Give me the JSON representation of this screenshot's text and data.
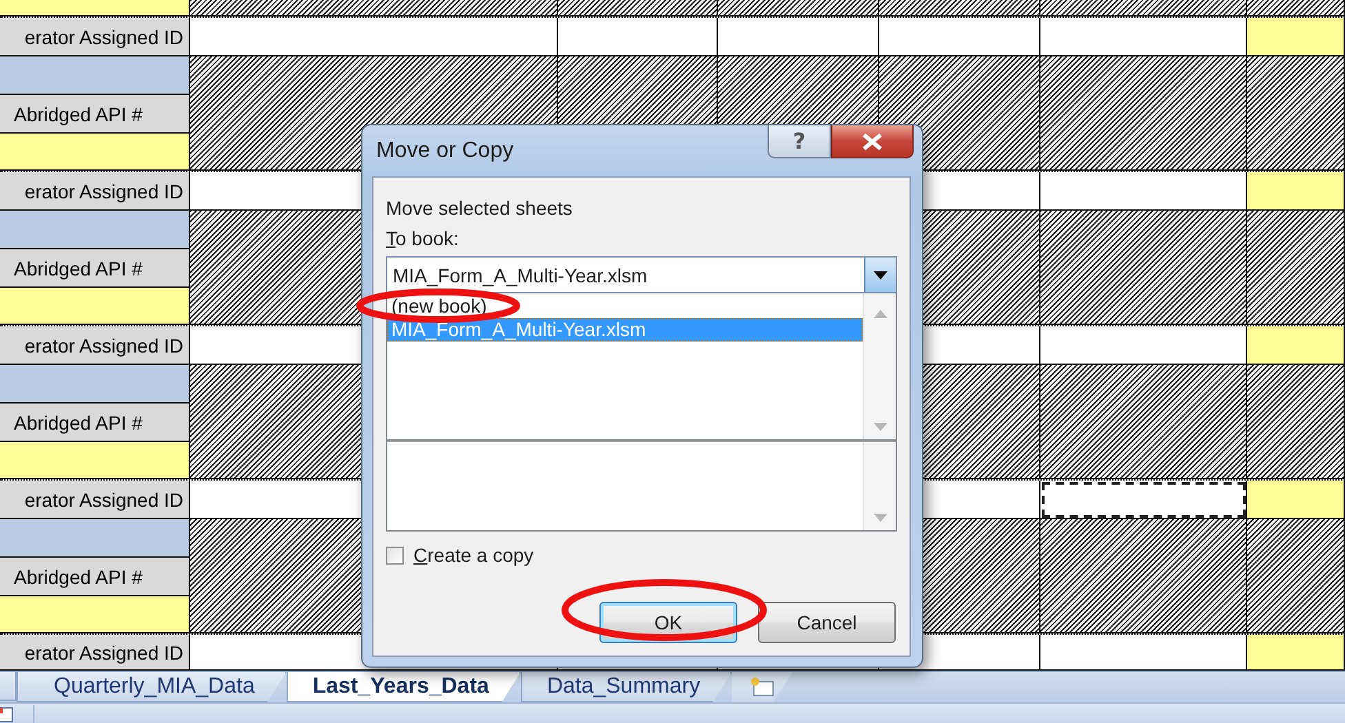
{
  "sheet": {
    "blocks": [
      {
        "id_label": "erator Assigned ID",
        "api_label": "Abridged API #",
        "selected": false
      },
      {
        "id_label": "erator Assigned ID",
        "api_label": "Abridged API #",
        "selected": false
      },
      {
        "id_label": "erator Assigned ID",
        "api_label": "Abridged API #",
        "selected": false
      },
      {
        "id_label": "erator Assigned ID",
        "api_label": "Abridged API #",
        "selected": true
      },
      {
        "id_label": "erator Assigned ID",
        "selected": false
      }
    ]
  },
  "sheet_tabs": [
    {
      "label": "Quarterly_MIA_Data",
      "selected": false
    },
    {
      "label": "Last_Years_Data",
      "selected": true
    },
    {
      "label": "Data_Summary",
      "selected": false
    }
  ],
  "dialog": {
    "title": "Move or Copy",
    "help_button": "?",
    "instruction": "Move selected sheets",
    "to_book_label": "To book:",
    "to_book_value": "MIA_Form_A_Multi-Year.xlsm",
    "list_items": [
      {
        "label": "(new book)",
        "selected": false,
        "circled": true
      },
      {
        "label": "MIA_Form_A_Multi-Year.xlsm",
        "selected": true,
        "circled": false
      }
    ],
    "create_copy": {
      "label": "Create a copy",
      "checked": false
    },
    "buttons": [
      {
        "label": "OK",
        "kind": "default",
        "circled": true
      },
      {
        "label": "Cancel",
        "kind": "normal",
        "circled": false
      }
    ]
  }
}
